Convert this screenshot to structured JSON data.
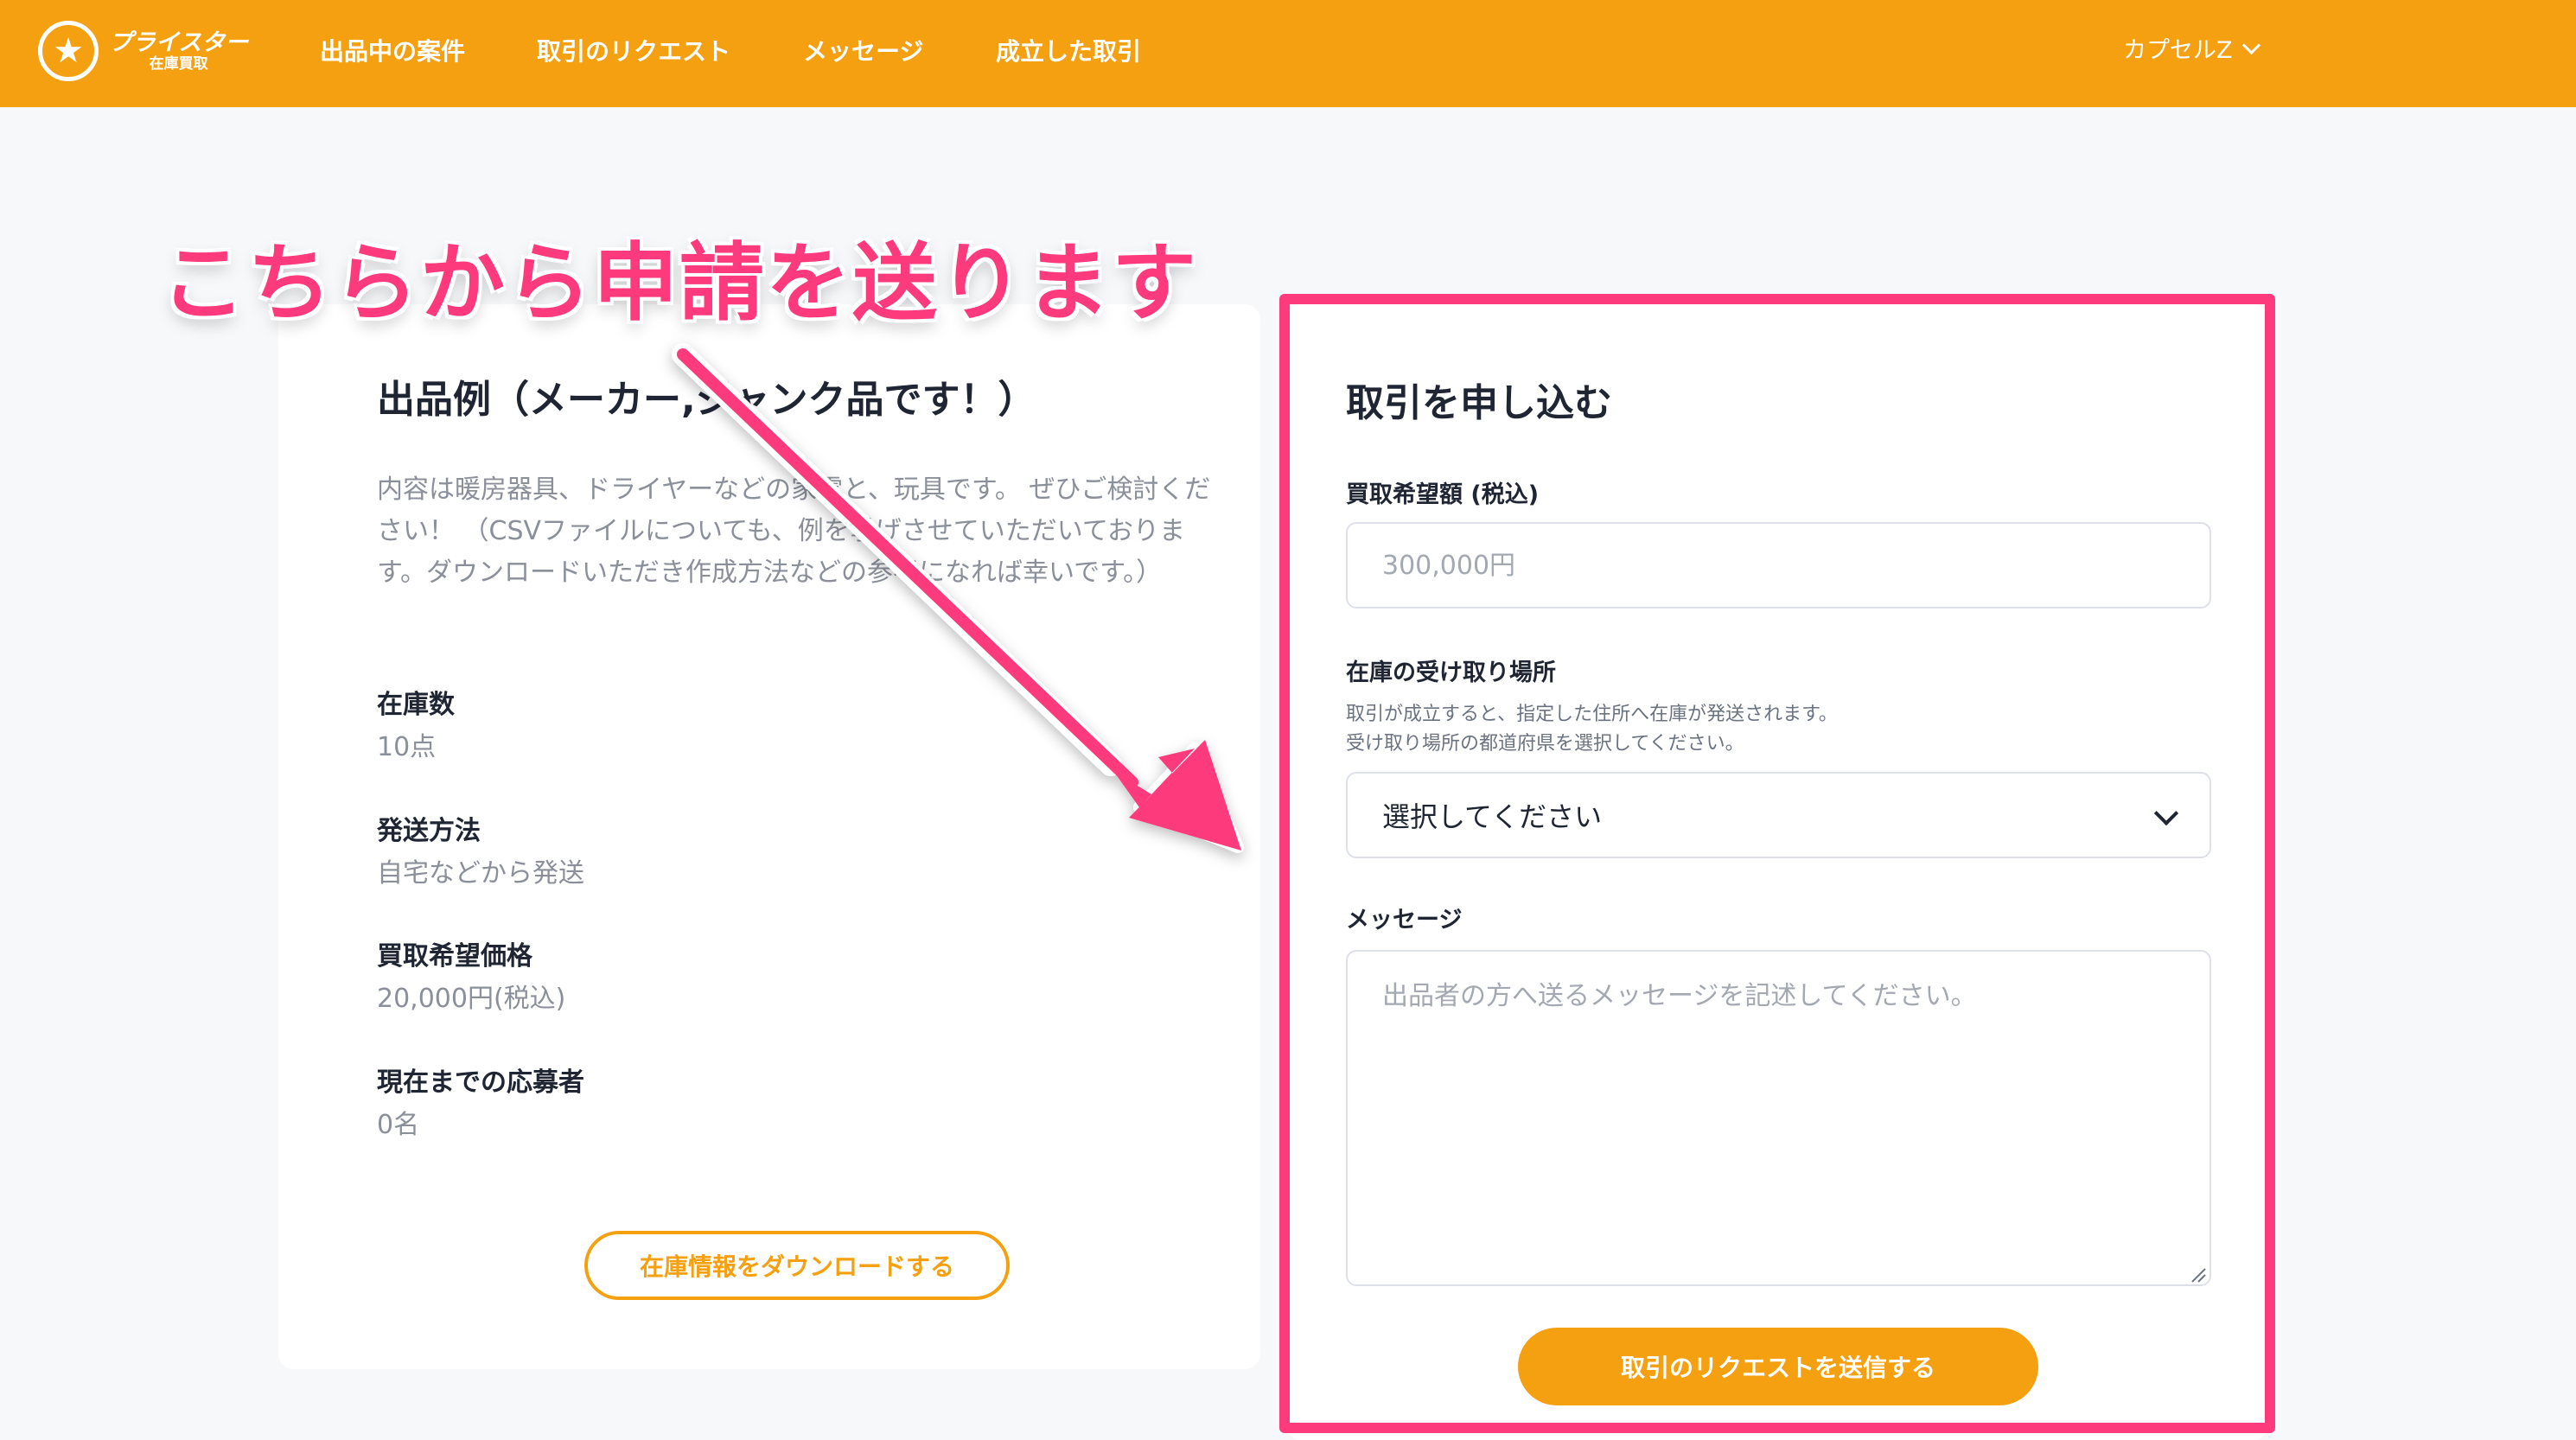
{
  "header": {
    "logo_name": "プライスター",
    "logo_sub": "在庫買取",
    "nav": [
      "出品中の案件",
      "取引のリクエスト",
      "メッセージ",
      "成立した取引"
    ],
    "user": "カプセルZ"
  },
  "listing": {
    "title": "出品例（メーカー,ジャンク品です！）",
    "description": "内容は暖房器具、ドライヤーなどの家電と、玩具です。 ぜひご検討ください！ （CSVファイルについても、例を挙げさせていただいております。ダウンロードいただき作成方法などの参考になれば幸いです。）",
    "fields": [
      {
        "label": "在庫数",
        "value": "10点"
      },
      {
        "label": "発送方法",
        "value": "自宅などから発送"
      },
      {
        "label": "買取希望価格",
        "value": "20,000円(税込)"
      },
      {
        "label": "現在までの応募者",
        "value": "0名"
      }
    ],
    "download_button": "在庫情報をダウンロードする"
  },
  "form": {
    "title": "取引を申し込む",
    "price_label": "買取希望額 (税込)",
    "price_placeholder": "300,000円",
    "location_label": "在庫の受け取り場所",
    "location_help_1": "取引が成立すると、指定した住所へ在庫が発送されます。",
    "location_help_2": "受け取り場所の都道府県を選択してください。",
    "location_select_value": "選択してください",
    "message_label": "メッセージ",
    "message_placeholder": "出品者の方へ送るメッセージを記述してください。",
    "submit_button": "取引のリクエストを送信する"
  },
  "annotation": {
    "callout": "こちらから申請を送ります",
    "color": "#fd3a7c"
  },
  "colors": {
    "brand": "#f4a010",
    "background": "#f7f8fa"
  },
  "icons": [
    "star-logo-icon",
    "chevron-down-icon"
  ]
}
